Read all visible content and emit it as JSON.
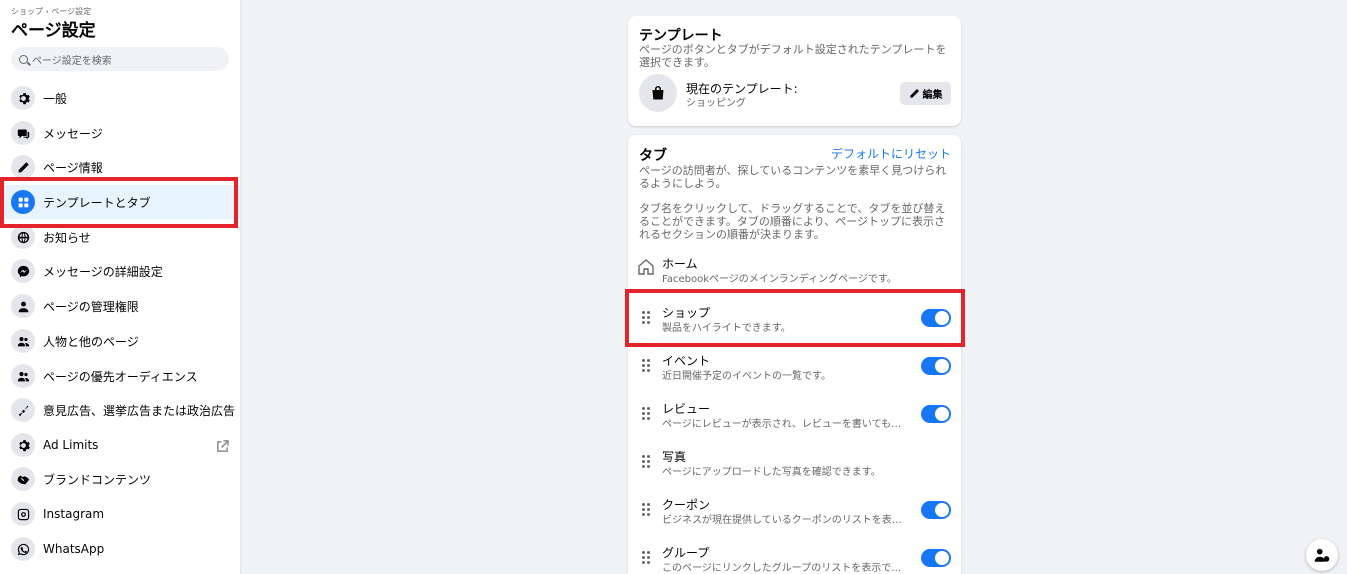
{
  "sidebar": {
    "breadcrumb": "ショップ › ページ設定",
    "title": "ページ設定",
    "search_placeholder": "ページ設定を検索",
    "items": [
      {
        "label": "一般",
        "icon": "gear-icon"
      },
      {
        "label": "メッセージ",
        "icon": "chat-icon"
      },
      {
        "label": "ページ情報",
        "icon": "pencil-icon"
      },
      {
        "label": "テンプレートとタブ",
        "icon": "grid-icon",
        "active": true
      },
      {
        "label": "お知らせ",
        "icon": "globe-icon"
      },
      {
        "label": "メッセージの詳細設定",
        "icon": "messenger-icon"
      },
      {
        "label": "ページの管理権限",
        "icon": "person-icon"
      },
      {
        "label": "人物と他のページ",
        "icon": "people-icon"
      },
      {
        "label": "ページの優先オーディエンス",
        "icon": "people-icon"
      },
      {
        "label": "意見広告、選挙広告または政治広告",
        "icon": "megaphone-icon"
      },
      {
        "label": "Ad Limits",
        "icon": "gear-icon",
        "external": true
      },
      {
        "label": "ブランドコンテンツ",
        "icon": "handshake-icon"
      },
      {
        "label": "Instagram",
        "icon": "instagram-icon"
      },
      {
        "label": "WhatsApp",
        "icon": "whatsapp-icon"
      }
    ]
  },
  "template_card": {
    "title": "テンプレート",
    "description": "ページのボタンとタブがデフォルト設定されたテンプレートを選択できます。",
    "current_label": "現在のテンプレート:",
    "current_value": "ショッピング",
    "edit_label": "編集"
  },
  "tabs_card": {
    "title": "タブ",
    "reset_label": "デフォルトにリセット",
    "description1": "ページの訪問者が、探しているコンテンツを素早く見つけられるようにしよう。",
    "description2": "タブ名をクリックして、ドラッグすることで、タブを並び替えることができます。タブの順番により、ページトップに表示されるセクションの順番が決まります。",
    "tabs": [
      {
        "name": "ホーム",
        "desc": "Facebookページのメインランディングページです。",
        "toggle": null,
        "home": true
      },
      {
        "name": "ショップ",
        "desc": "製品をハイライトできます。",
        "toggle": true
      },
      {
        "name": "イベント",
        "desc": "近日開催予定のイベントの一覧です。",
        "toggle": true
      },
      {
        "name": "レビュー",
        "desc": "ページにレビューが表示され、レビューを書いても…",
        "toggle": true
      },
      {
        "name": "写真",
        "desc": "ページにアップロードした写真を確認できます。",
        "toggle": null
      },
      {
        "name": "クーポン",
        "desc": "ビジネスが現在提供しているクーポンのリストを表…",
        "toggle": true
      },
      {
        "name": "グループ",
        "desc": "このページにリンクしたグループのリストを表示で…",
        "toggle": true
      }
    ]
  },
  "colors": {
    "accent": "#1877f2",
    "highlight": "#e3242b"
  }
}
